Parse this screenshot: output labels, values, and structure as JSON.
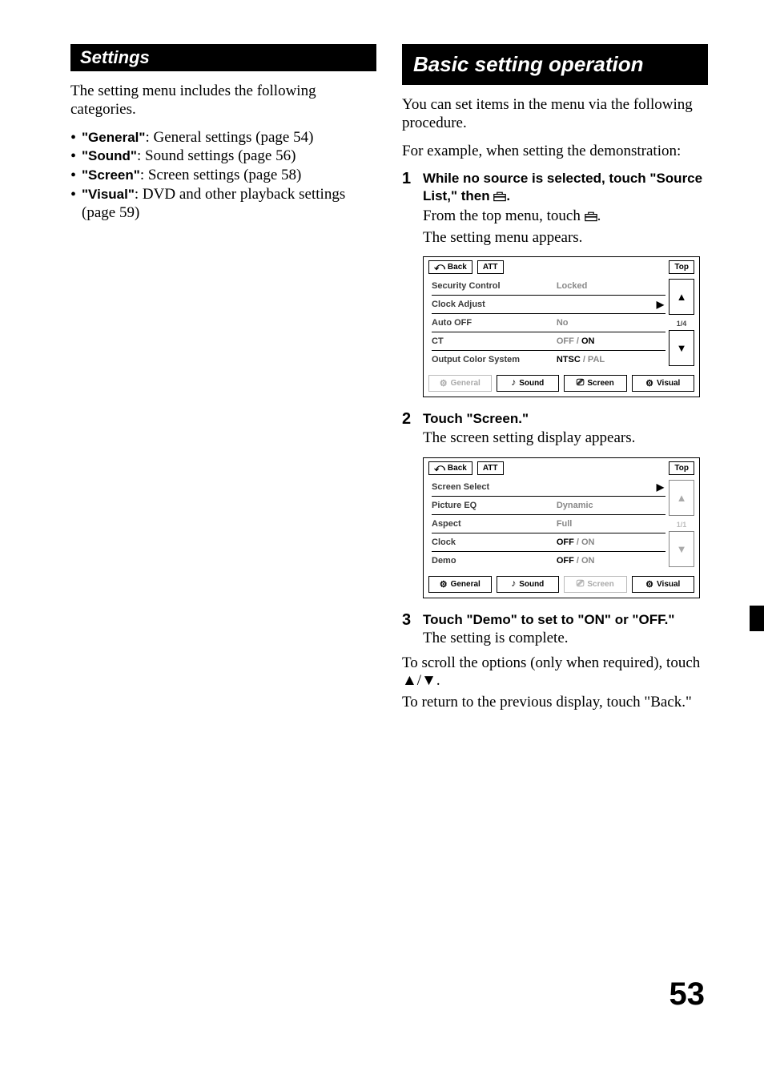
{
  "page_number": "53",
  "left": {
    "heading": "Settings",
    "intro": "The setting menu includes the following categories.",
    "bullets": [
      {
        "name": "\"General\"",
        "desc": ": General settings (page 54)"
      },
      {
        "name": "\"Sound\"",
        "desc": ": Sound settings (page 56)"
      },
      {
        "name": "\"Screen\"",
        "desc": ": Screen settings (page 58)"
      },
      {
        "name": "\"Visual\"",
        "desc": ": DVD and other playback settings (page 59)"
      }
    ]
  },
  "right": {
    "heading": "Basic setting operation",
    "intro1": "You can set items in the menu via the following procedure.",
    "intro2": "For example, when setting the demonstration:",
    "steps": {
      "s1": {
        "num": "1",
        "title_a": "While no source is selected, touch \"Source List,\" then ",
        "title_b": ".",
        "line1": "From the top menu, touch ",
        "line1b": ".",
        "line2": "The setting menu appears."
      },
      "s2": {
        "num": "2",
        "title": "Touch \"Screen.\"",
        "line1": "The screen setting display appears."
      },
      "s3": {
        "num": "3",
        "title": "Touch \"Demo\" to set to \"ON\" or \"OFF.\"",
        "line1": "The setting is complete."
      }
    },
    "footer1": "To scroll the options (only when required), touch ",
    "footer_arrows": "▲/▼",
    "footer1b": ".",
    "footer2": "To return to the previous display, touch \"Back.\"",
    "menu_common": {
      "back": "Back",
      "att": "ATT",
      "top": "Top",
      "tabs": {
        "general": "General",
        "sound": "Sound",
        "screen": "Screen",
        "visual": "Visual"
      }
    },
    "menu1": {
      "page_ind": "1/4",
      "rows": [
        {
          "lbl": "Security Control",
          "val_dim": "Locked",
          "val_on": "",
          "chev": ""
        },
        {
          "lbl": "Clock Adjust",
          "val_dim": "",
          "val_on": "",
          "chev": "▶"
        },
        {
          "lbl": "Auto OFF",
          "val_dim": "No",
          "val_on": "",
          "chev": ""
        },
        {
          "lbl": "CT",
          "val_dim": "OFF / ",
          "val_on": "ON",
          "chev": ""
        },
        {
          "lbl": "Output Color System",
          "val_dim": " / PAL",
          "val_on": "NTSC",
          "chev": ""
        }
      ]
    },
    "menu2": {
      "page_ind": "1/1",
      "rows": [
        {
          "lbl": "Screen Select",
          "val_dim": "",
          "val_on": "",
          "chev": "▶"
        },
        {
          "lbl": "Picture EQ",
          "val_dim": "Dynamic",
          "val_on": "",
          "chev": ""
        },
        {
          "lbl": "Aspect",
          "val_dim": "Full",
          "val_on": "",
          "chev": ""
        },
        {
          "lbl": "Clock",
          "val_dim": " / ON",
          "val_on": "OFF",
          "chev": ""
        },
        {
          "lbl": "Demo",
          "val_dim": " / ON",
          "val_on": "OFF",
          "chev": ""
        }
      ]
    }
  }
}
